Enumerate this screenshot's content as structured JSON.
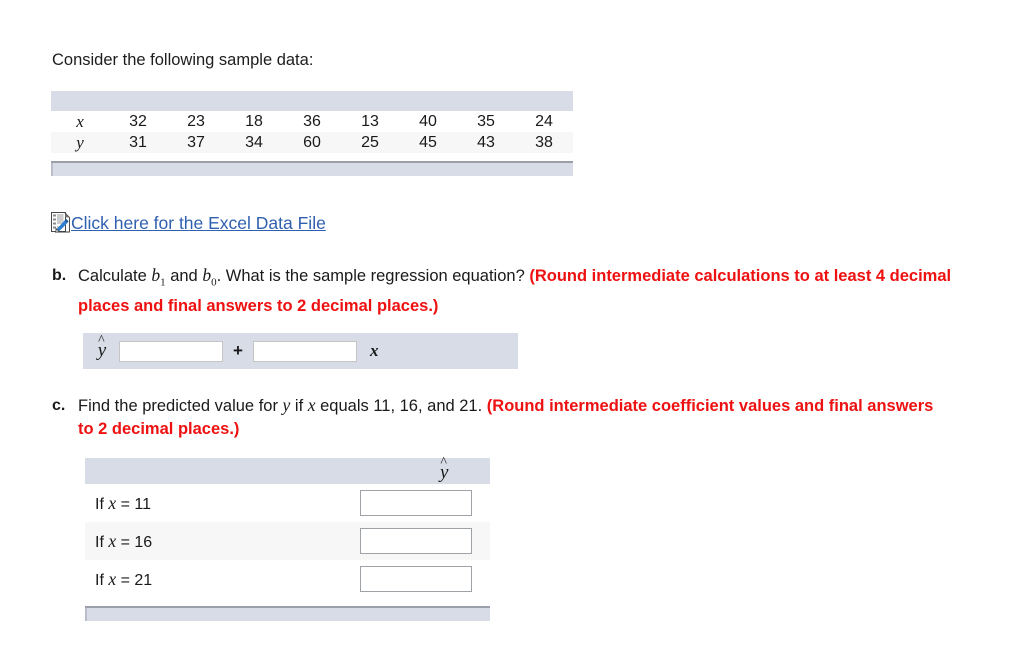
{
  "intro": {
    "text": "Consider the following sample data:"
  },
  "data_table": {
    "rows": [
      {
        "label": "x",
        "values": [
          "32",
          "23",
          "18",
          "36",
          "13",
          "40",
          "35",
          "24"
        ]
      },
      {
        "label": "y",
        "values": [
          "31",
          "37",
          "34",
          "60",
          "25",
          "45",
          "43",
          "38"
        ]
      }
    ],
    "header_color": "#d7dce6",
    "alt_row_color": "#f7f7f7"
  },
  "excel_link": {
    "icon": "excel-document-icon",
    "label": "Click here for the Excel Data File",
    "color": "#3060b0"
  },
  "question_b": {
    "marker": "b.",
    "text_part1": "Calculate ",
    "b1": "b",
    "b1_sub": "1",
    "text_part2": " and ",
    "b0": "b",
    "b0_sub": "0",
    "text_part3": ". What is the sample regression equation? ",
    "red_text": "(Round intermediate calculations to at least 4 decimal places and final answers to 2 decimal places.)",
    "red_color": "#ee1111"
  },
  "equation_panel": {
    "yhat": "y",
    "yhat_accent": "^",
    "intercept_value": "",
    "intercept_placeholder": "",
    "plus": "+",
    "slope_value": "",
    "slope_placeholder": "",
    "x_label": "x"
  },
  "question_c": {
    "marker": "c.",
    "text_part1": "Find the predicted value for ",
    "y_var": "y",
    "text_part2": " if ",
    "x_var": "x",
    "text_part3": " equals 11, 16, and 21. ",
    "red_text": "(Round intermediate coefficient values and final answers to 2 decimal places.)",
    "red_color": "#ee1111"
  },
  "pred_table": {
    "header_yhat": "y",
    "header_yhat_accent": "^",
    "rows": [
      {
        "label_prefix": "If ",
        "var": "x",
        "label_suffix": " = 11",
        "value": "",
        "placeholder": ""
      },
      {
        "label_prefix": "If ",
        "var": "x",
        "label_suffix": " = 16",
        "value": "",
        "placeholder": ""
      },
      {
        "label_prefix": "If ",
        "var": "x",
        "label_suffix": " = 21",
        "value": "",
        "placeholder": ""
      }
    ],
    "header_color": "#d7dce6",
    "alt_row_color": "#f7f7f7"
  }
}
